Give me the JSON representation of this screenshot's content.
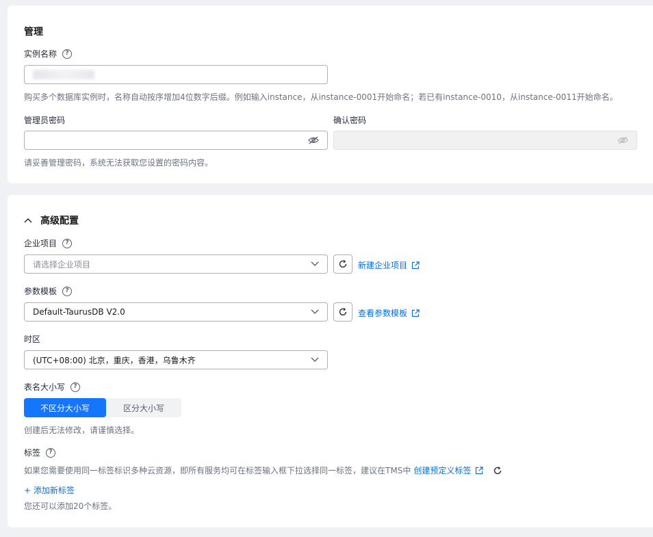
{
  "management": {
    "title": "管理",
    "instance_name": {
      "label": "实例名称",
      "hint": "购买多个数据库实例时，名称自动按序增加4位数字后缀。例如输入instance，从instance-0001开始命名；若已有instance-0010，从instance-0011开始命名。"
    },
    "admin_password": {
      "label": "管理员密码",
      "hint": "请妥善管理密码，系统无法获取您设置的密码内容。"
    },
    "confirm_password": {
      "label": "确认密码"
    }
  },
  "advanced": {
    "title": "高级配置",
    "enterprise_project": {
      "label": "企业项目",
      "placeholder": "请选择企业项目",
      "link": "新建企业项目"
    },
    "param_template": {
      "label": "参数模板",
      "value": "Default-TaurusDB V2.0",
      "link": "查看参数模板"
    },
    "timezone": {
      "label": "时区",
      "value": "(UTC+08:00) 北京，重庆，香港，乌鲁木齐"
    },
    "table_case": {
      "label": "表名大小写",
      "options": [
        "不区分大小写",
        "区分大小写"
      ],
      "selected": "不区分大小写",
      "hint": "创建后无法修改，请谨慎选择。"
    },
    "tags": {
      "label": "标签",
      "hint": "如果您需要使用同一标签标识多种云资源，即所有服务均可在标签输入框下拉选择同一标签，建议在TMS中",
      "link": "创建预定义标签",
      "add_label": "+ 添加新标签",
      "remaining": "您还可以添加20个标签。"
    }
  },
  "colors": {
    "primary": "#1476ff",
    "link": "#0a6dd8",
    "background": "#f0f1f4"
  }
}
